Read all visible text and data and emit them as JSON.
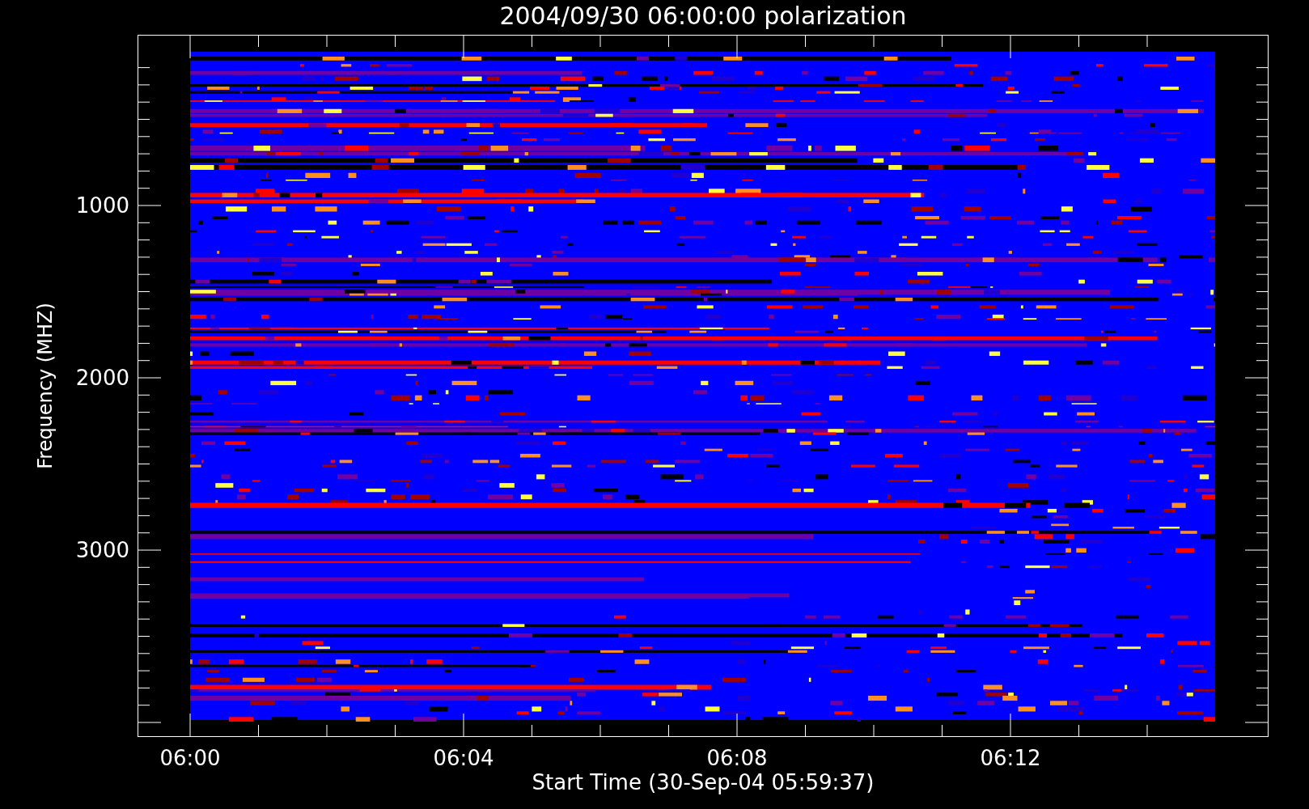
{
  "title": "2004/09/30 06:00:00 polarization",
  "y_axis": {
    "label": "Frequency (MHZ)",
    "tick_labels": [
      "1000",
      "2000",
      "3000"
    ]
  },
  "x_axis": {
    "label": "Start Time (30-Sep-04 05:59:37)",
    "tick_labels": [
      "06:00",
      "06:04",
      "06:08",
      "06:12"
    ]
  }
}
